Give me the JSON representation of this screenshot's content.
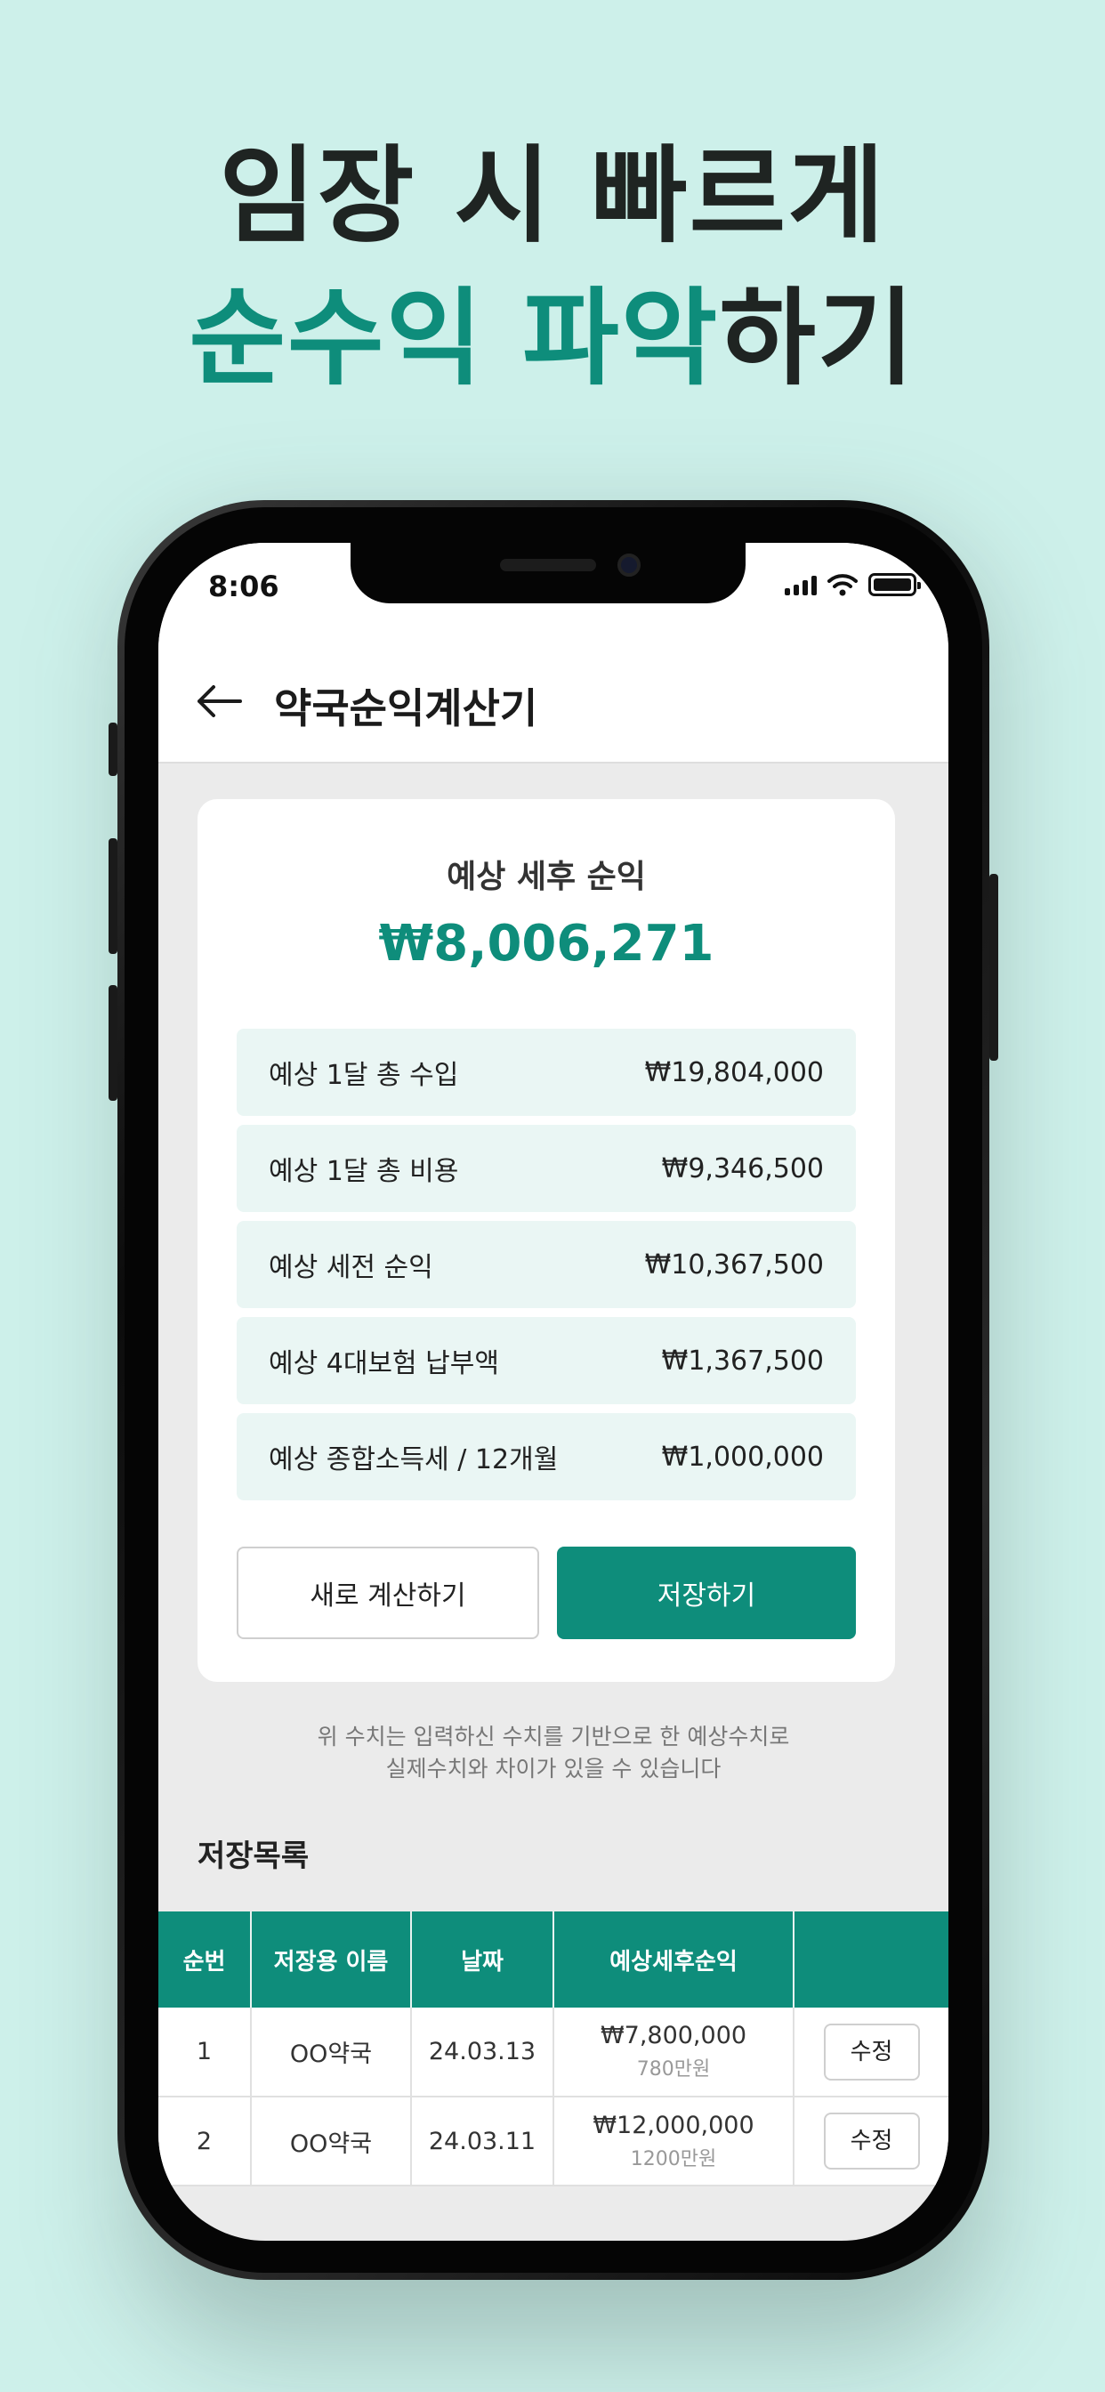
{
  "promo": {
    "line1": "임장 시 빠르게",
    "line2_accent": "순수익 파악",
    "line2_rest": "하기"
  },
  "status_bar": {
    "time": "8:06"
  },
  "app_bar": {
    "title": "약국순익계산기"
  },
  "summary": {
    "label": "예상 세후 순익",
    "amount": "₩8,006,271",
    "rows": [
      {
        "label": "예상 1달 총 수입",
        "value": "₩19,804,000"
      },
      {
        "label": "예상 1달 총 비용",
        "value": "₩9,346,500"
      },
      {
        "label": "예상 세전 순익",
        "value": "₩10,367,500"
      },
      {
        "label": "예상 4대보험 납부액",
        "value": "₩1,367,500"
      },
      {
        "label": "예상 종합소득세 / 12개월",
        "value": "₩1,000,000"
      }
    ],
    "recalc_label": "새로 계산하기",
    "save_label": "저장하기"
  },
  "notice": {
    "line1": "위 수치는 입력하신 수치를 기반으로 한 예상수치로",
    "line2": "실제수치와 차이가 있을 수 있습니다"
  },
  "saved": {
    "title": "저장목록",
    "columns": [
      "순번",
      "저장용 이름",
      "날짜",
      "예상세후순익",
      ""
    ],
    "rows": [
      {
        "no": "1",
        "name": "OO약국",
        "date": "24.03.13",
        "profit": "₩7,800,000",
        "profit_short": "780만원",
        "edit": "수정"
      },
      {
        "no": "2",
        "name": "OO약국",
        "date": "24.03.11",
        "profit": "₩12,000,000",
        "profit_short": "1200만원",
        "edit": "수정"
      }
    ]
  },
  "colors": {
    "accent": "#0e8d7b",
    "background": "#cdf0ea",
    "row_bg": "#eaf6f4"
  }
}
